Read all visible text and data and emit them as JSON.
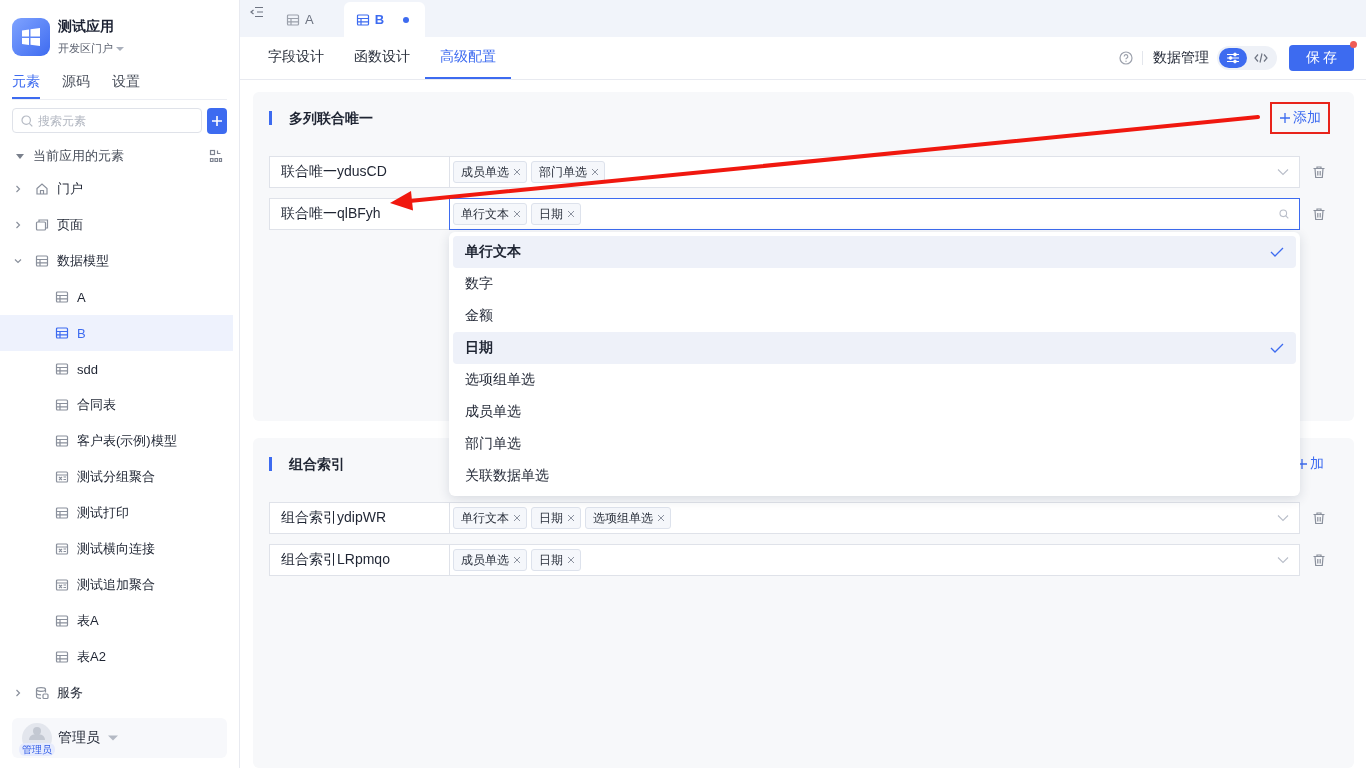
{
  "app": {
    "name": "测试应用",
    "portal": "开发区门户"
  },
  "sidebar": {
    "tabs": [
      {
        "label": "元素",
        "selected": true
      },
      {
        "label": "源码",
        "selected": false
      },
      {
        "label": "设置",
        "selected": false
      }
    ],
    "search": {
      "placeholder": "搜索元素"
    },
    "tree_title": "当前应用的元素",
    "tree_expanded": true,
    "items": [
      {
        "label": "门户",
        "kind": "home",
        "expanded": false,
        "selected": false
      },
      {
        "label": "页面",
        "kind": "page",
        "expanded": false,
        "selected": false
      },
      {
        "label": "数据模型",
        "kind": "table",
        "expanded": true,
        "selected": false,
        "children": [
          {
            "label": "A",
            "kind": "table",
            "selected": false
          },
          {
            "label": "B",
            "kind": "table",
            "selected": true
          },
          {
            "label": "sdd",
            "kind": "table",
            "selected": false
          },
          {
            "label": "合同表",
            "kind": "table",
            "selected": false
          },
          {
            "label": "客户表(示例)模型",
            "kind": "table",
            "selected": false
          },
          {
            "label": "测试分组聚合",
            "kind": "aggregate",
            "selected": false
          },
          {
            "label": "测试打印",
            "kind": "table",
            "selected": false
          },
          {
            "label": "测试横向连接",
            "kind": "aggregate",
            "selected": false
          },
          {
            "label": "测试追加聚合",
            "kind": "aggregate",
            "selected": false
          },
          {
            "label": "表A",
            "kind": "table",
            "selected": false
          },
          {
            "label": "表A2",
            "kind": "table",
            "selected": false
          }
        ]
      },
      {
        "label": "服务",
        "kind": "service",
        "expanded": false,
        "selected": false
      }
    ],
    "user": {
      "name": "管理员",
      "badge": "管理员"
    }
  },
  "editor_tabs": [
    {
      "label": "A",
      "selected": false,
      "modified": false
    },
    {
      "label": "B",
      "selected": true,
      "modified": true
    }
  ],
  "design_tabs": [
    {
      "label": "字段设计",
      "selected": false
    },
    {
      "label": "函数设计",
      "selected": false
    },
    {
      "label": "高级配置",
      "selected": true
    }
  ],
  "toolbar": {
    "label": "数据管理",
    "modes": [
      {
        "kind": "settings",
        "selected": true
      },
      {
        "kind": "code",
        "selected": false
      }
    ],
    "save": "保 存",
    "save_badge": true
  },
  "sections": [
    {
      "title": "多列联合唯一",
      "add": "添加",
      "highlighted": true,
      "rows": [
        {
          "name": "联合唯一ydusCD",
          "tags": [
            "成员单选",
            "部门单选"
          ],
          "focused": false
        },
        {
          "name": "联合唯一qlBFyh",
          "tags": [
            "单行文本",
            "日期"
          ],
          "focused": true,
          "options": [
            {
              "label": "单行文本",
              "selected": true
            },
            {
              "label": "数字",
              "selected": false
            },
            {
              "label": "金额",
              "selected": false
            },
            {
              "label": "日期",
              "selected": true
            },
            {
              "label": "选项组单选",
              "selected": false
            },
            {
              "label": "成员单选",
              "selected": false
            },
            {
              "label": "部门单选",
              "selected": false
            },
            {
              "label": "关联数据单选",
              "selected": false
            }
          ]
        }
      ]
    },
    {
      "title": "组合索引",
      "add": "加",
      "highlighted": false,
      "rows": [
        {
          "name": "组合索引ydipWR",
          "tags": [
            "单行文本",
            "日期",
            "选项组单选"
          ],
          "focused": false
        },
        {
          "name": "组合索引LRpmqo",
          "tags": [
            "成员单选",
            "日期"
          ],
          "focused": false
        }
      ]
    }
  ],
  "arrow": true
}
